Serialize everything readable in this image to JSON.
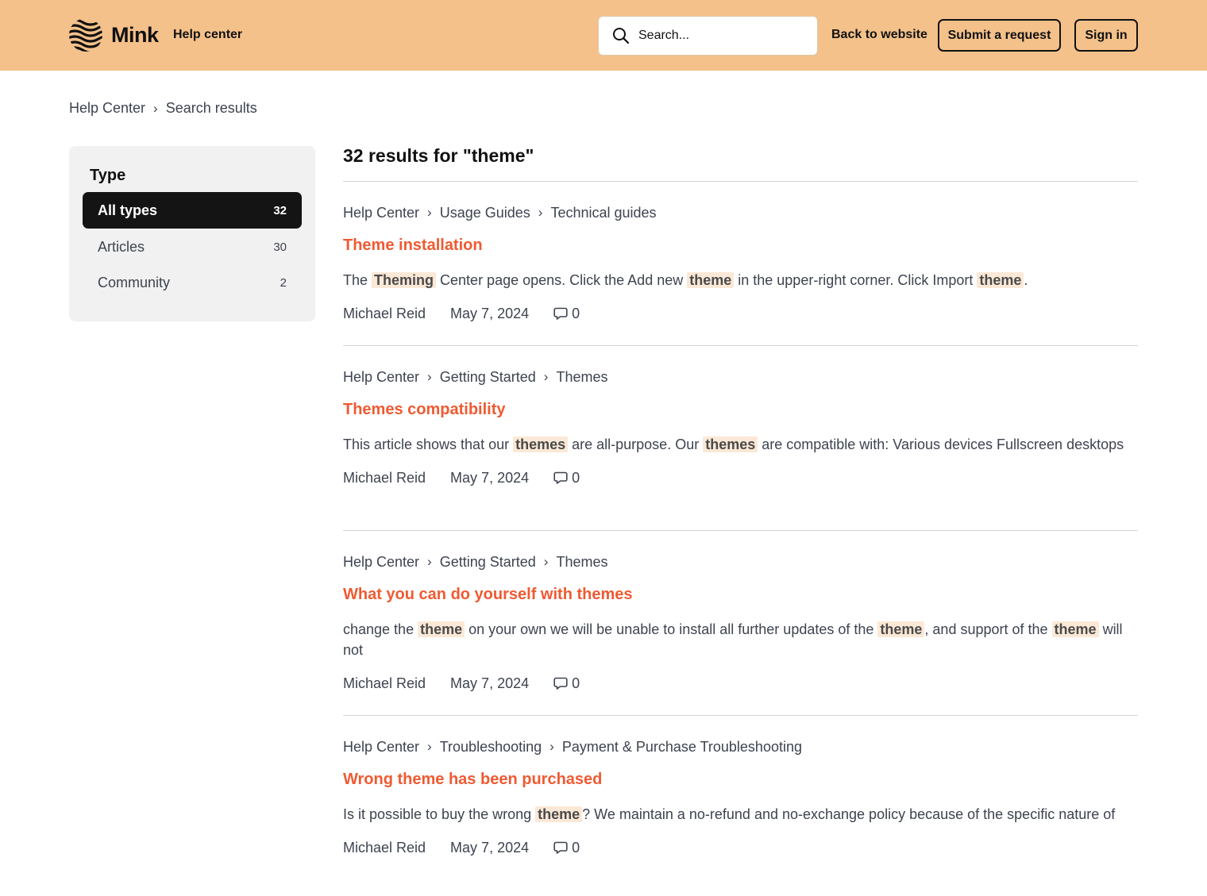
{
  "header": {
    "brand": "Mink",
    "help_center": "Help center",
    "search_placeholder": "Search...",
    "back_to_website": "Back to website",
    "submit_request": "Submit a request",
    "sign_in": "Sign in",
    "bg_color": "#f4c18a"
  },
  "breadcrumb": [
    "Help Center",
    "Search results"
  ],
  "sidebar": {
    "title": "Type",
    "filters": [
      {
        "label": "All types",
        "count": "32",
        "active": true
      },
      {
        "label": "Articles",
        "count": "30",
        "active": false
      },
      {
        "label": "Community",
        "count": "2",
        "active": false
      }
    ]
  },
  "results": {
    "heading": "32 results for \"theme\"",
    "items": [
      {
        "crumbs": [
          "Help Center",
          "Usage Guides",
          "Technical guides"
        ],
        "title": "Theme installation",
        "snippet": [
          {
            "t": "The "
          },
          {
            "t": "Theming",
            "hl": true
          },
          {
            "t": " Center page opens. Click the Add new "
          },
          {
            "t": "theme",
            "hl": true
          },
          {
            "t": " in the upper-right corner. Click Import "
          },
          {
            "t": "theme",
            "hl": true
          },
          {
            "t": "."
          }
        ],
        "author": "Michael Reid",
        "date": "May 7, 2024",
        "comments": "0"
      },
      {
        "crumbs": [
          "Help Center",
          "Getting Started",
          "Themes"
        ],
        "title": "Themes compatibility",
        "snippet": [
          {
            "t": "This article shows that our "
          },
          {
            "t": "themes",
            "hl": true
          },
          {
            "t": " are all-purpose. Our "
          },
          {
            "t": "themes",
            "hl": true
          },
          {
            "t": " are compatible with: Various devices Fullscreen desktops"
          }
        ],
        "author": "Michael Reid",
        "date": "May 7, 2024",
        "comments": "0"
      },
      {
        "crumbs": [
          "Help Center",
          "Getting Started",
          "Themes"
        ],
        "title": "What you can do yourself with themes",
        "snippet": [
          {
            "t": "change the "
          },
          {
            "t": "theme",
            "hl": true
          },
          {
            "t": " on your own we will be unable to install all further updates of the "
          },
          {
            "t": "theme",
            "hl": true
          },
          {
            "t": ", and support of the "
          },
          {
            "t": "theme",
            "hl": true
          },
          {
            "t": " will not"
          }
        ],
        "author": "Michael Reid",
        "date": "May 7, 2024",
        "comments": "0"
      },
      {
        "crumbs": [
          "Help Center",
          "Troubleshooting",
          "Payment & Purchase Troubleshooting"
        ],
        "title": "Wrong theme has been purchased",
        "snippet": [
          {
            "t": "Is it possible to buy the wrong "
          },
          {
            "t": "theme",
            "hl": true
          },
          {
            "t": "? We maintain a no-refund and no-exchange policy because of the specific nature of"
          }
        ],
        "author": "Michael Reid",
        "date": "May 7, 2024",
        "comments": "0"
      }
    ]
  },
  "colors": {
    "accent_title": "#ef5a32",
    "highlight_bg": "#fbe8d6",
    "active_filter_bg": "#141414"
  },
  "icons": {
    "logo": "wave-lines-logo-icon",
    "search": "search-icon",
    "comment": "comment-bubble-icon",
    "chevron": "chevron-right-icon"
  }
}
